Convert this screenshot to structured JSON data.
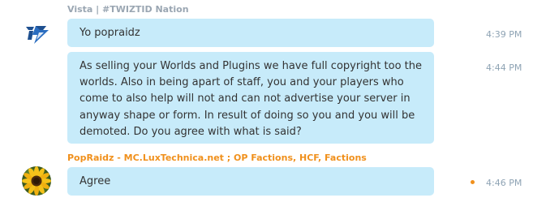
{
  "messages": [
    {
      "sender": "Vista | #TWIZTID Nation",
      "avatar_icon": "twiztid-logo-icon",
      "entries": [
        {
          "text": "Yo popraidz",
          "time": "4:39 PM"
        },
        {
          "text": "As selling your Worlds and Plugins we have full copyright too the worlds. Also in being apart of staff, you and your players who come to also help will not and can not advertise your server in anyway shape or form. In result of doing so you and you will be demoted. Do you agree with what is said?",
          "time": "4:44 PM"
        }
      ]
    },
    {
      "sender": "PopRaidz - MC.LuxTechnica.net ; OP Factions, HCF, Factions",
      "avatar_icon": "sunflower-avatar-icon",
      "entries": [
        {
          "text": "Agree",
          "time": "4:46 PM"
        }
      ]
    }
  ],
  "colors": {
    "bubble": "#c7ebfa",
    "sender_self": "#9aa6b2",
    "sender_other": "#f0901c",
    "timestamp": "#8ea3b4",
    "unread_dot": "#f0901c"
  }
}
